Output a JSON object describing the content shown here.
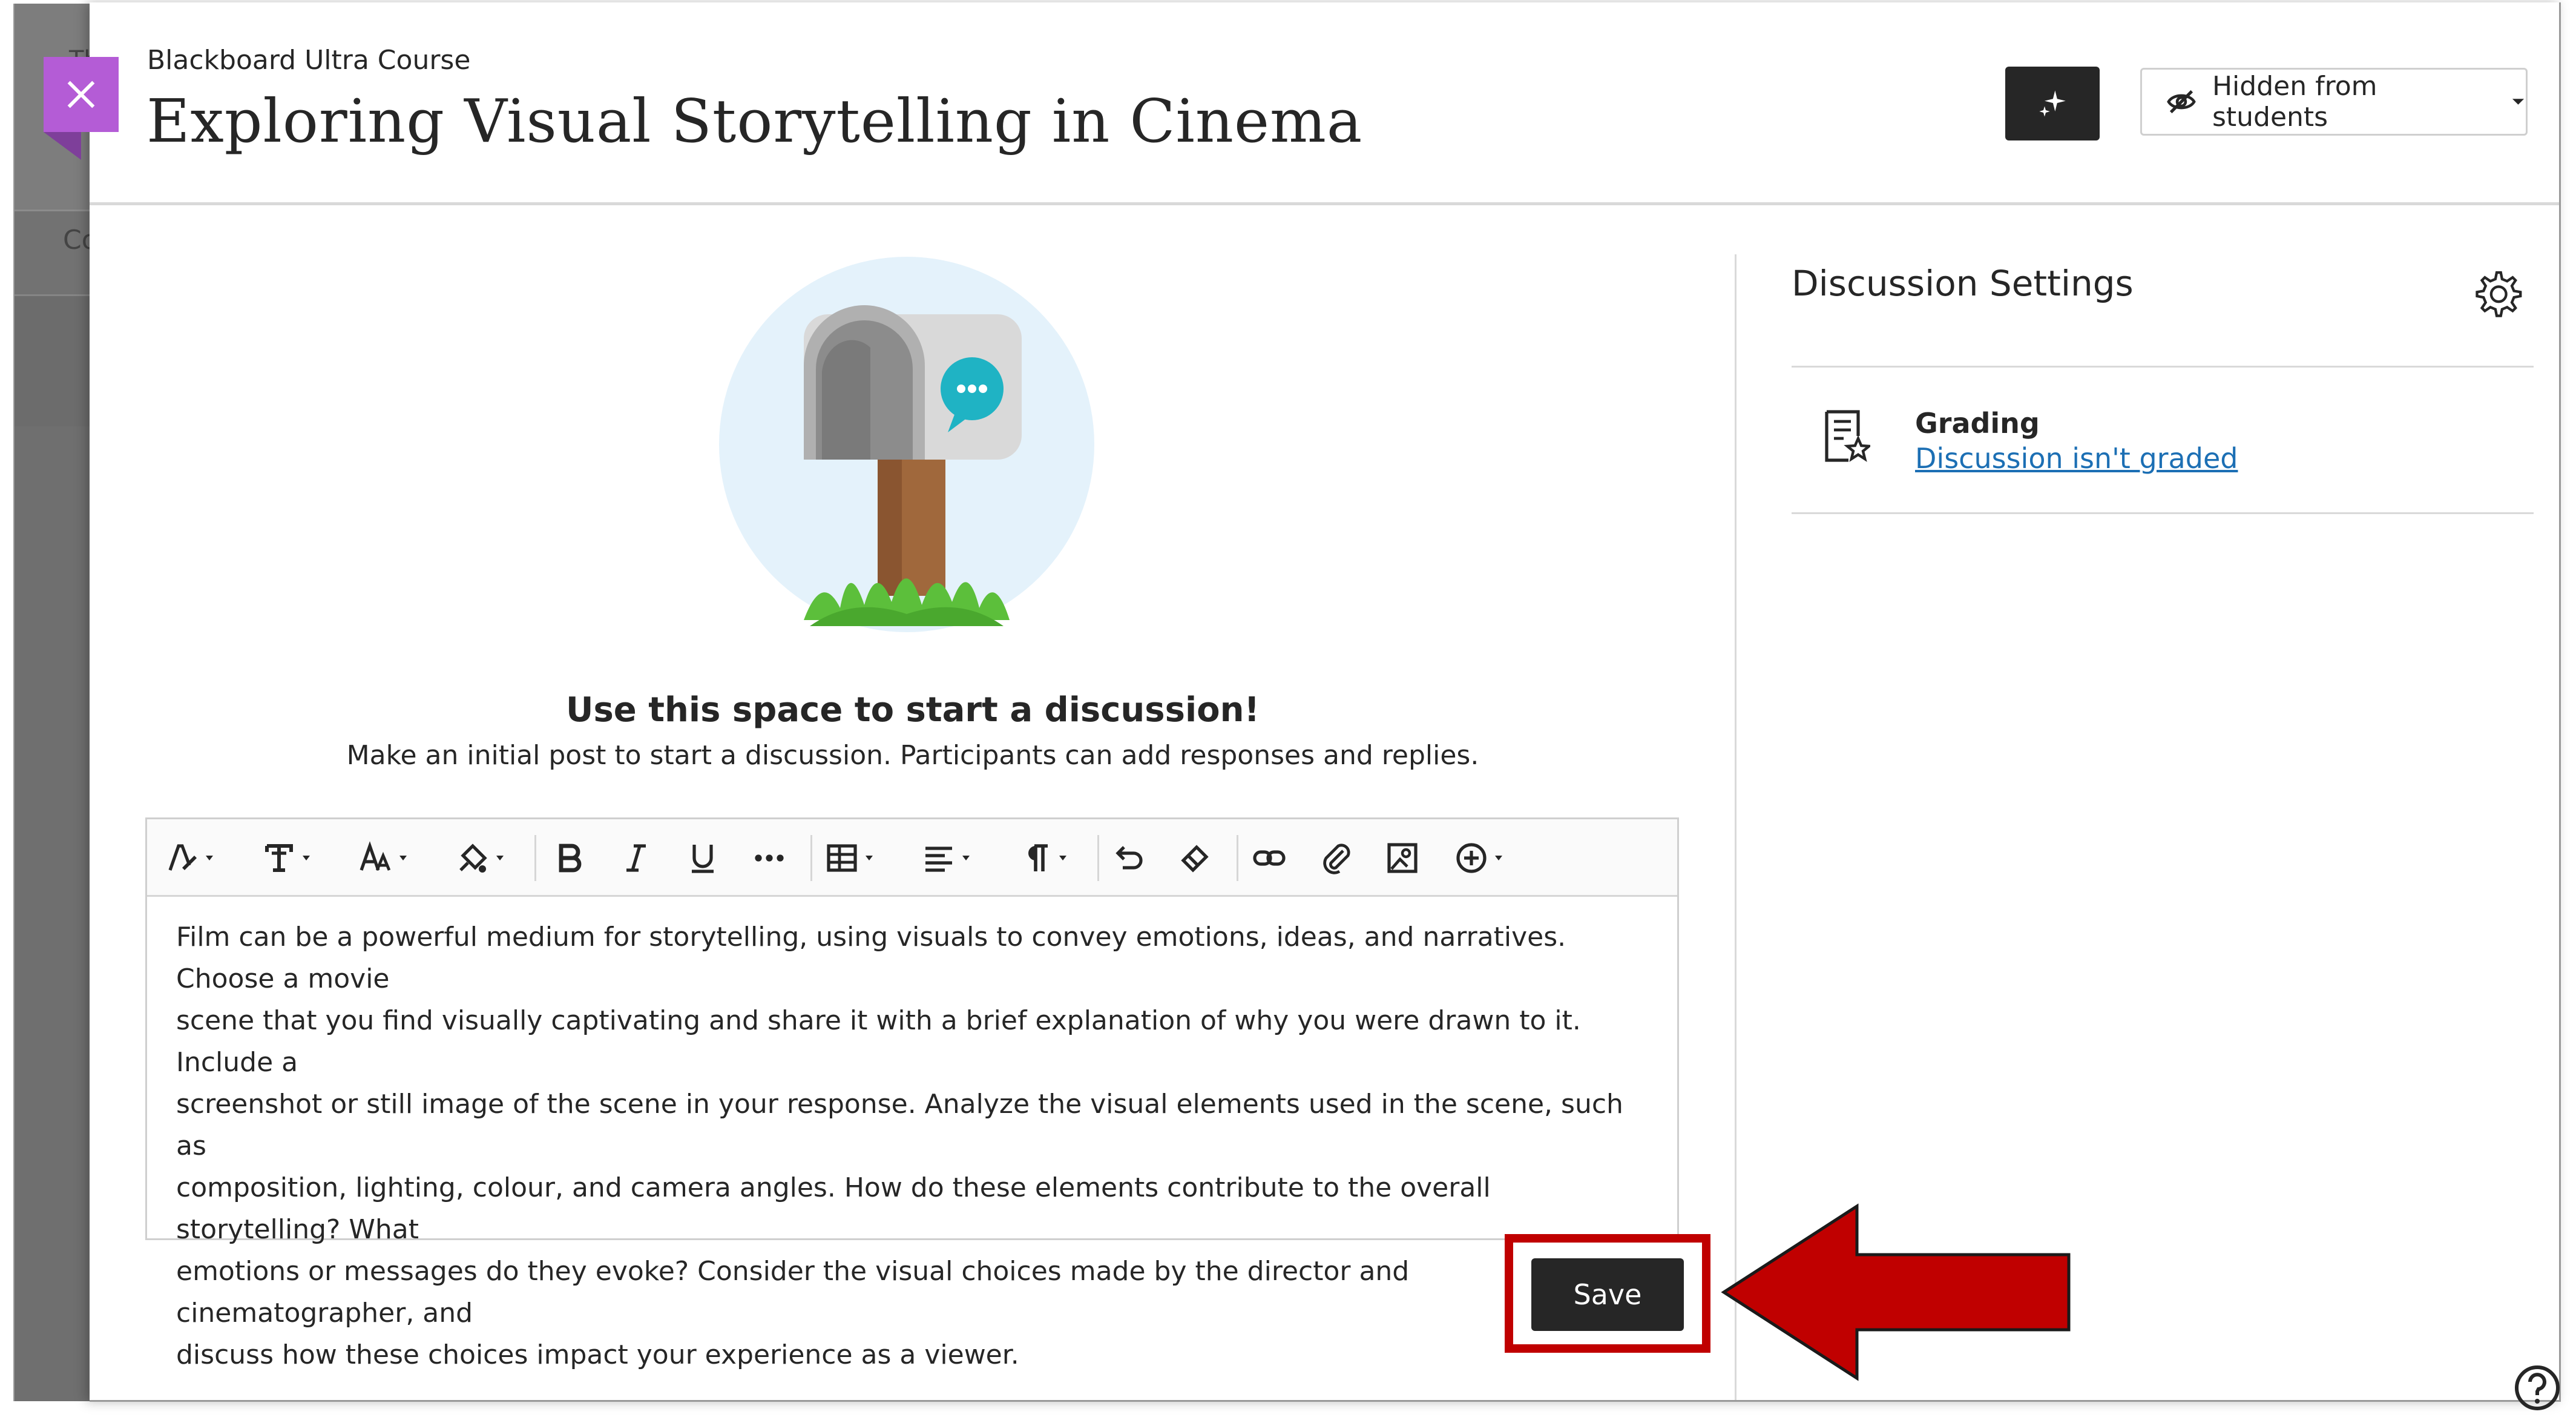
{
  "header": {
    "course_label": "Blackboard Ultra Course",
    "title": "Exploring Visual Storytelling in Cinema",
    "visibility_label": "Hidden from students"
  },
  "background": {
    "row1_fragment": "Th",
    "row2_fragment": "Co"
  },
  "discussion": {
    "heading": "Use this space to start a discussion!",
    "subtext": "Make an initial post to start a discussion. Participants can add responses and replies.",
    "body_lines": [
      "Film can be a powerful medium for storytelling, using visuals to convey emotions, ideas, and narratives. Choose a movie",
      "scene that you find visually captivating and share it with a brief explanation of why you were drawn to it. Include a",
      "screenshot or still image of the scene in your response. Analyze the visual elements used in the scene, such as",
      "composition, lighting, colour, and camera angles. How do these elements contribute to the overall storytelling? What",
      "emotions or messages do they evoke? Consider the visual choices made by the director and cinematographer, and",
      "discuss how these choices impact your experience as a viewer."
    ],
    "save_label": "Save"
  },
  "toolbar_icons": [
    "text-style-icon",
    "font-type-icon",
    "font-size-icon",
    "highlight-color-icon",
    "bold-icon",
    "italic-icon",
    "underline-icon",
    "more-icon",
    "table-icon",
    "align-icon",
    "paragraph-icon",
    "undo-icon",
    "clear-format-icon",
    "link-icon",
    "attach-icon",
    "image-icon",
    "insert-content-icon"
  ],
  "settings": {
    "title": "Discussion Settings",
    "grading_label": "Grading",
    "grading_link": "Discussion isn't graded"
  },
  "colors": {
    "close_tab": "#b45cd6",
    "highlight": "#c00000",
    "link": "#1c6fb4",
    "dark_button": "#262626"
  }
}
